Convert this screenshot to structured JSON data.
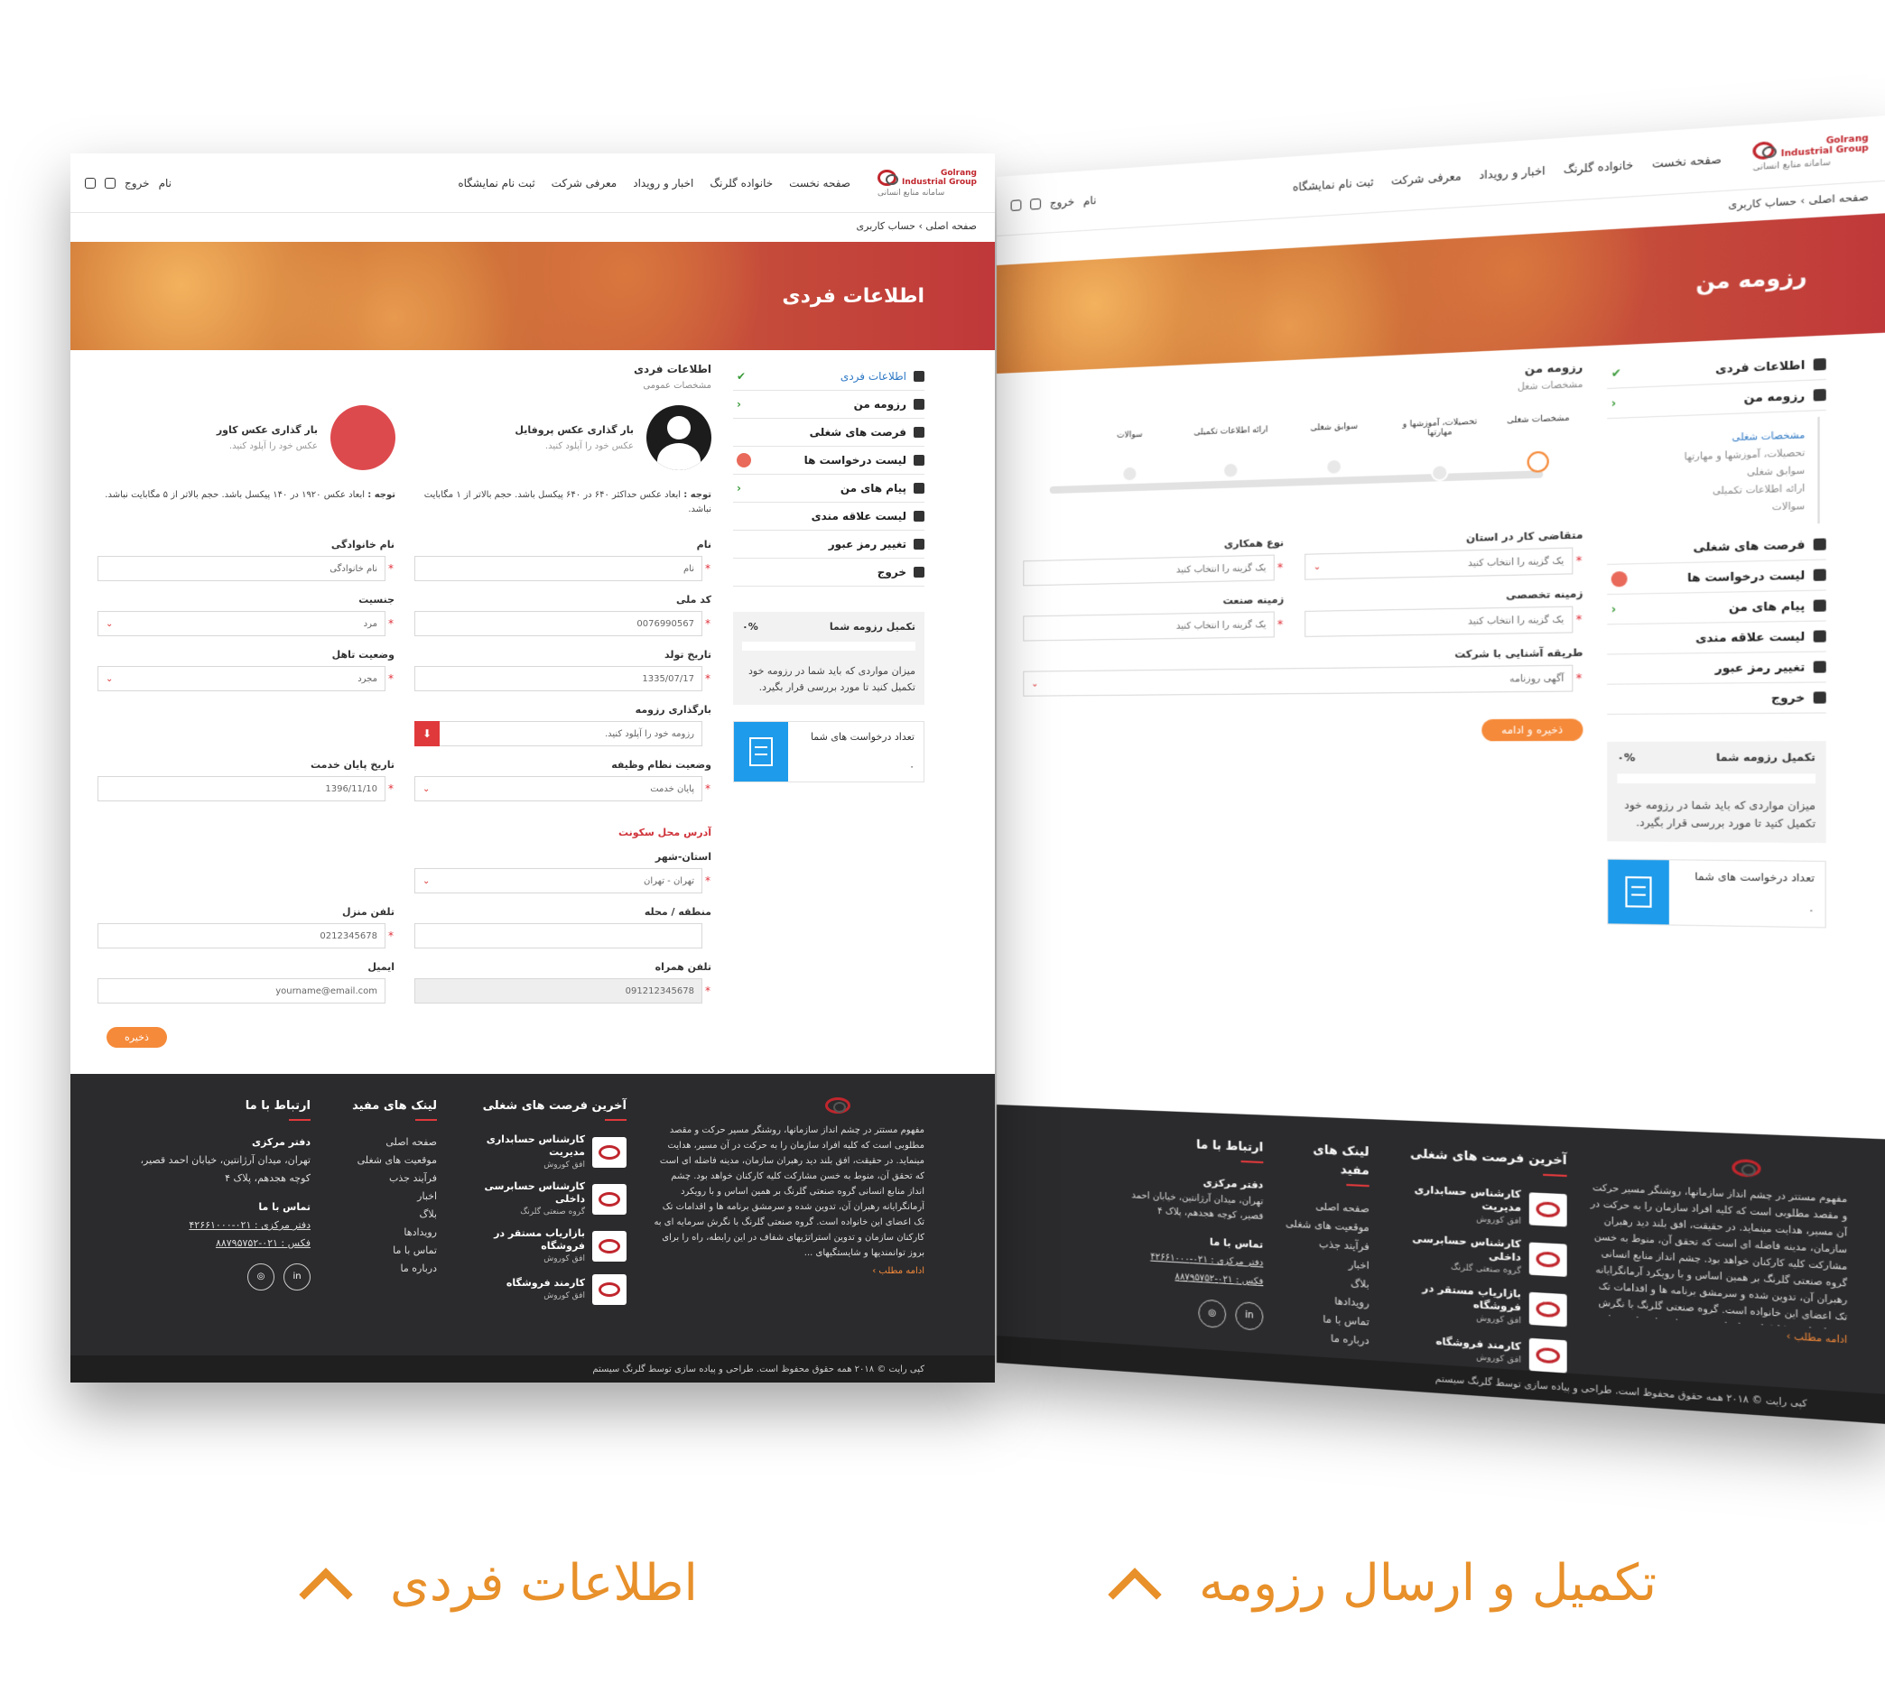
{
  "header": {
    "logo_brand": "Golrang Industrial Group",
    "logo_tagline": "سامانه منابع انسانی",
    "nav": [
      "صفحه نخست",
      "خانواده گلرنگ",
      "اخبار و رویداد",
      "معرفی شرکت",
      "ثبت نام نمایشگاه"
    ],
    "user_name": "نام",
    "logout": "خروج"
  },
  "breadcrumb": {
    "home": "صفحه اصلی",
    "sep": "›",
    "current": "حساب کاربری"
  },
  "sidebar": {
    "items": [
      "اطلاعات فردی",
      "رزومه من",
      "فرصت های شغلی",
      "لیست درخواست ها",
      "پیام های من",
      "لیست علاقه مندی",
      "تغییر رمز عبور",
      "خروج"
    ],
    "resume_sub": [
      "مشخصات شغلی",
      "تحصیلات، آموزشها و مهارتها",
      "سوابق شغلی",
      "ارائه اطلاعات تکمیلی",
      "سوالات"
    ],
    "progress_title": "تکمیل رزومه شما",
    "progress_value": "۰%",
    "progress_desc": "میزان مواردی که باید شما در رزومه خود تکمیل کنید تا مورد بررسی قرار بگیرد.",
    "requests_title": "تعداد درخواست های شما",
    "requests_count": "۰"
  },
  "left_page": {
    "banner_title": "اطلاعات فردی",
    "section_title": "اطلاعات فردی",
    "section_sub": "مشخصات عمومی",
    "profile_upload": "بار گذاری عکس پروفایل",
    "cover_upload": "بار گذاری عکس کاور",
    "upload_hint": "عکس خود را آپلود کنید.",
    "profile_note_label": "توجه :",
    "profile_note": "ابعاد عکس حداکثر ۶۴۰ در ۶۴۰ پیکسل باشد. حجم بالاتر از ۱ مگابایت نباشد.",
    "cover_note": "ابعاد عکس ۱۹۲۰ در ۱۴۰ پیکسل باشد. حجم بالاتر از ۵ مگابایت نباشد.",
    "fields": {
      "first_name": {
        "label": "نام",
        "value": "نام"
      },
      "last_name": {
        "label": "نام خانوادگی",
        "value": "نام خانوادگی"
      },
      "national_code": {
        "label": "کد ملی",
        "value": "0076990567"
      },
      "gender": {
        "label": "جنسیت",
        "value": "مرد"
      },
      "birth_date": {
        "label": "تاریخ تولد",
        "value": "1335/07/17"
      },
      "marital": {
        "label": "وضعیت تاهل",
        "value": "مجرد"
      },
      "resume_upload": {
        "label": "بارگذاری رزومه",
        "placeholder": "رزومه خود را آپلود کنید."
      },
      "military": {
        "label": "وضعیت نظام وظیفه",
        "value": "پایان خدمت"
      },
      "service_end": {
        "label": "تاریخ پایان خدمت",
        "value": "1396/11/10"
      },
      "address_title": "آدرس محل سکونت",
      "province": {
        "label": "استان-شهر",
        "value": "تهران - تهران"
      },
      "region": {
        "label": "منطقه / محله",
        "value": ""
      },
      "home_phone": {
        "label": "تلفن منزل",
        "value": "0212345678"
      },
      "mobile": {
        "label": "تلفن همراه",
        "value": "091212345678"
      },
      "email": {
        "label": "ایمیل",
        "placeholder": "yourname@email.com"
      }
    },
    "save": "ذخیره"
  },
  "right_page": {
    "banner_title": "رزومه من",
    "section_title": "رزومه من",
    "section_sub": "مشخصات شغل",
    "steps": [
      "مشخصات شغلی",
      "تحصیلات، آموزشها و مهارتها",
      "سوابق شغلی",
      "ارائه اطلاعات تکمیلی",
      "سوالات"
    ],
    "fields": {
      "job_applicant": {
        "label": "متقاضی کار در استان",
        "placeholder": "یک گزینه را انتخاب کنید"
      },
      "coop_type": {
        "label": "نوع همکاری",
        "placeholder": "یک گزینه را انتخاب کنید"
      },
      "specialty": {
        "label": "زمینه تخصصی",
        "placeholder": "یک گزینه را انتخاب کنید"
      },
      "industry": {
        "label": "زمینه صنعت",
        "placeholder": "یک گزینه را انتخاب کنید"
      },
      "acquaint": {
        "label": "طریقه آشنایی با شرکت",
        "value": "آگهی روزنامه"
      }
    },
    "save": "ذخیره و ادامه"
  },
  "footer": {
    "about": "مفهوم مستتر در چشم انداز سازمانها، روشنگر مسیر حرکت و مقصد مطلوبی است که کلیه افراد سازمان را به حرکت در آن مسیر، هدایت مینماید. در حقیقت، افق بلند دید رهبران سازمان، مدینه فاضله ای است که تحقق آن، منوط به خسن مشارکت کلیه کارکنان خواهد بود. چشم انداز منابع انسانی گروه صنعتی گلرنگ بر همین اساس و با رویکرد آرمانگرایانه رهبران آن، تدوین شده و سرمشق برنامه ها و اقدامات تک تک اعضای این خانواده است. گروه صنعتی گلرنگ با نگرش سرمایه ای به کارکنان سازمان و تدوین استراتژیهای شفاف در این رابطه، راه را برای بروز توانمندیها و شایستگیهای ...",
    "more": "ادامه مطلب ›",
    "jobs_title": "آخرین فرصت های شغلی",
    "jobs": [
      {
        "title": "کارشناس حسابداری مدیریت",
        "company": "افق کوروش"
      },
      {
        "title": "کارشناس حسابرسی داخلی",
        "company": "گروه صنعتی گلرنگ"
      },
      {
        "title": "بازاریاب مستقر در فروشگاه",
        "company": "افق کوروش"
      },
      {
        "title": "کارمند فروشگاه",
        "company": "افق کوروش"
      }
    ],
    "links_title": "لینک های مفید",
    "links": [
      "صفحه اصلی",
      "موقعیت های شغلی",
      "فرآیند جذب",
      "اخبار",
      "بلاگ",
      "رویدادها",
      "تماس با ما",
      "درباره ما"
    ],
    "contact_title": "ارتباط با ما",
    "office_label": "دفتر مرکزی",
    "office_address": "تهران، میدان آرژانتین، خیابان احمد قصیر، کوچه هجدهم، پلاک ۴",
    "contact_label": "تماس با ما",
    "phone": "دفتر مرکزی : ۰۲۱-۴۲۶۶۱۰۰۰",
    "fax": "فکس : ۰۲۱-۸۸۷۹۵۷۵۲",
    "copyright": "کپی رایت © ۲۰۱۸ همه حقوق محفوظ است. طراحی و پیاده سازی توسط گلرنگ سیستم"
  },
  "captions": {
    "left": "اطلاعات فردی",
    "right": "تکمیل و ارسال رزومه"
  },
  "colors": {
    "accent": "#e8902a",
    "brand_red": "#c0262d",
    "footer": "#2b2b2d",
    "button": "#f58a3a",
    "info_blue": "#1e9bea"
  }
}
